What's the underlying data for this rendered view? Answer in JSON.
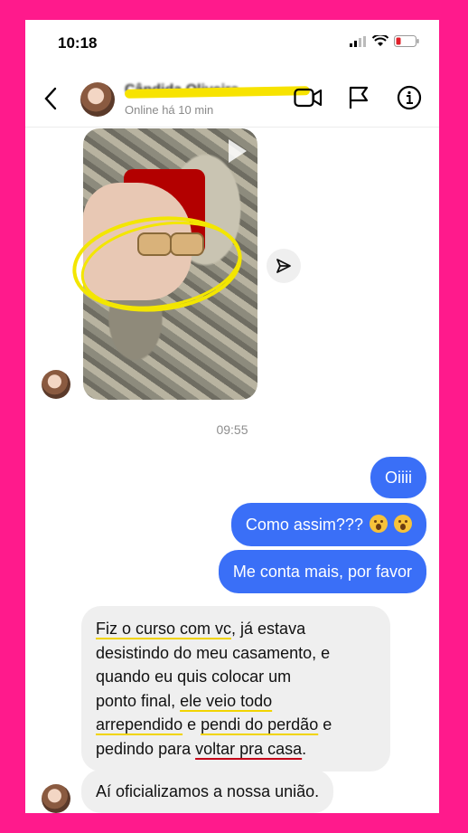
{
  "status_bar": {
    "time": "10:18"
  },
  "header": {
    "contact_name": "Cândida Oliveira",
    "online_status": "Online há 10 min",
    "icons": [
      "back-icon",
      "video-call-icon",
      "flag-icon",
      "info-icon"
    ]
  },
  "thread": {
    "media_icon": "play-icon",
    "share_icon": "share-icon",
    "timestamp": "09:55",
    "outgoing": [
      {
        "text": "Oiiii"
      },
      {
        "text": "Como assim???",
        "emoji": "astonished-face-icon"
      },
      {
        "text": "Me conta mais, por favor"
      }
    ],
    "incoming": {
      "lines": [
        [
          "Fiz o curso com vc",
          ", já estava"
        ],
        [
          "desistindo do meu casamento, e"
        ],
        [
          "quando eu quis colocar um"
        ],
        [
          "ponto final, ",
          "ele veio todo"
        ],
        [
          "arrependido",
          " e ",
          "pendi do perdão",
          " e"
        ],
        [
          "pedindo para ",
          "voltar pra casa",
          "."
        ]
      ],
      "last_message": "Aí oficializamos a nossa união."
    }
  },
  "colors": {
    "frame": "#ff1a8c",
    "outgoing_bubble": "#3a6ff7",
    "incoming_bubble": "#efefef",
    "highlight_yellow": "#f1d400",
    "highlight_red": "#c40018"
  }
}
